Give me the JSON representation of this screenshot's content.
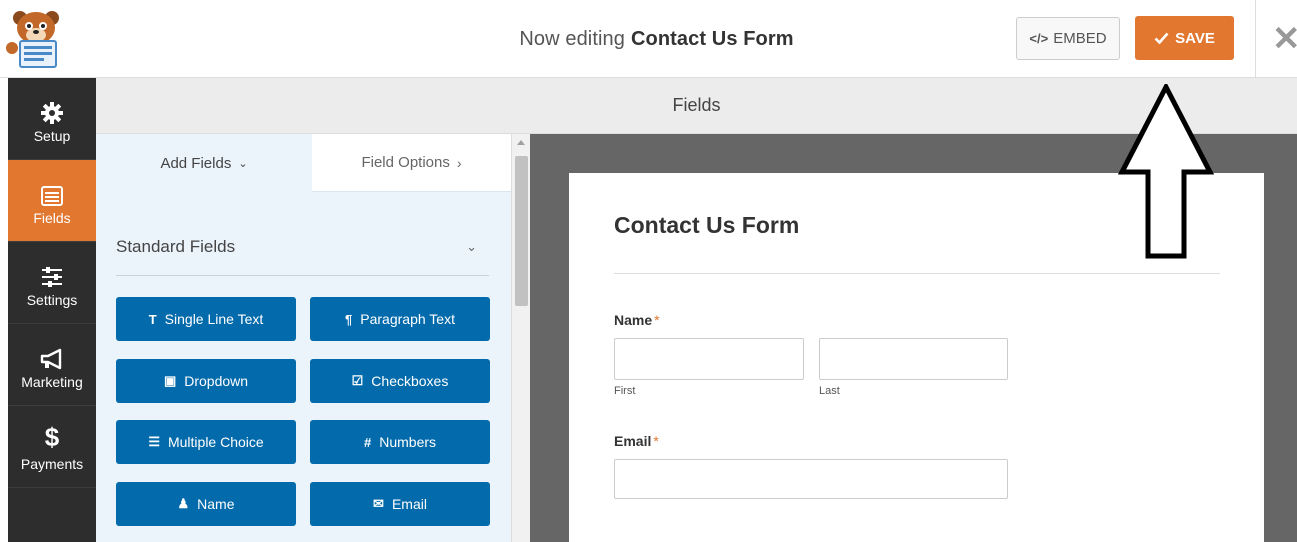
{
  "header": {
    "editing_prefix": "Now editing",
    "form_name": "Contact Us Form",
    "embed_label": "EMBED",
    "embed_icon": "code-icon",
    "save_label": "SAVE",
    "save_icon": "check-icon",
    "close_icon": "close-icon",
    "logo": "bear-mascot-logo"
  },
  "sidebar": {
    "items": [
      {
        "label": "Setup",
        "icon": "gear-icon"
      },
      {
        "label": "Fields",
        "icon": "form-list-icon",
        "active": true
      },
      {
        "label": "Settings",
        "icon": "sliders-icon"
      },
      {
        "label": "Marketing",
        "icon": "megaphone-icon"
      },
      {
        "label": "Payments",
        "icon": "dollar-icon"
      }
    ]
  },
  "fieldsbar": {
    "title": "Fields"
  },
  "panel": {
    "tab_add": "Add Fields",
    "tab_options": "Field Options",
    "section_title": "Standard Fields",
    "buttons": [
      {
        "label": "Single Line Text",
        "icon": "T"
      },
      {
        "label": "Paragraph Text",
        "icon": "¶"
      },
      {
        "label": "Dropdown",
        "icon": "▣"
      },
      {
        "label": "Checkboxes",
        "icon": "☑"
      },
      {
        "label": "Multiple Choice",
        "icon": "☰"
      },
      {
        "label": "Numbers",
        "icon": "#"
      },
      {
        "label": "Name",
        "icon": "♟"
      },
      {
        "label": "Email",
        "icon": "✉"
      }
    ]
  },
  "preview": {
    "form_title": "Contact Us Form",
    "name_label": "Name",
    "name_first": "First",
    "name_last": "Last",
    "email_label": "Email",
    "required_mark": "*"
  },
  "colors": {
    "accent": "#e27730",
    "field_button": "#036aab",
    "sidebar": "#2d2d2d",
    "preview_bg": "#666666"
  }
}
